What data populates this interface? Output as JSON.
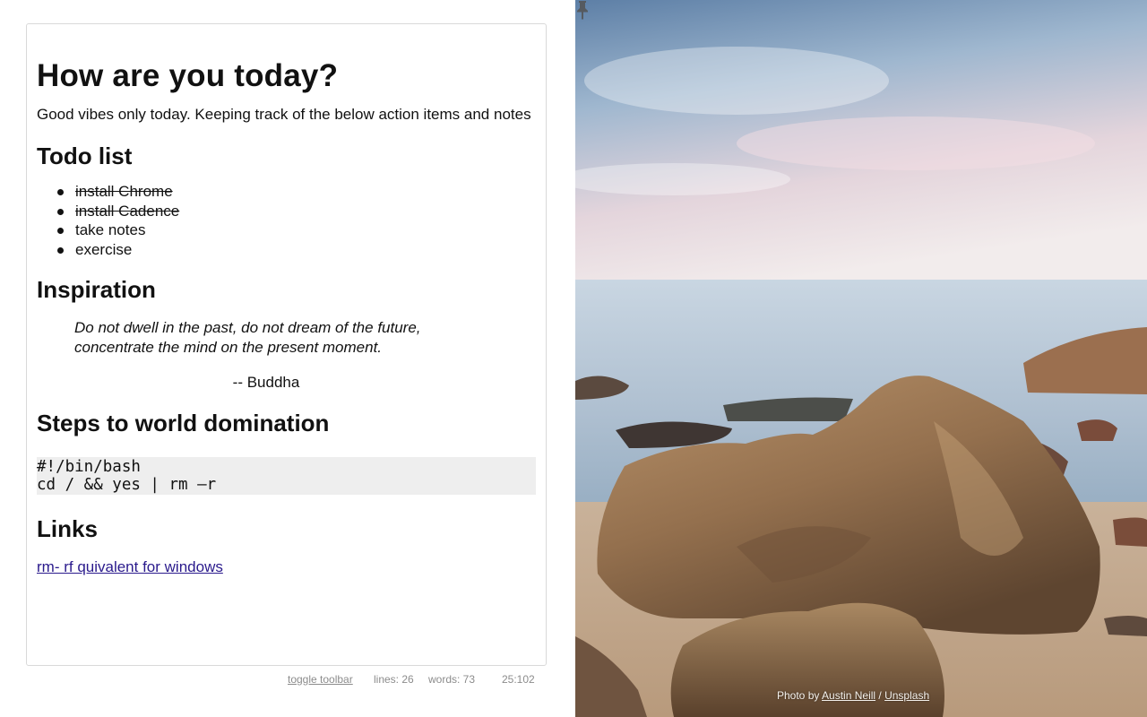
{
  "document": {
    "title": "How are you today?",
    "intro": "Good vibes only today. Keeping track of the below action items and notes",
    "todo_heading": "Todo list",
    "todos": [
      {
        "text": "install Chrome",
        "done": true
      },
      {
        "text": "install Cadence",
        "done": true
      },
      {
        "text": "take notes",
        "done": false
      },
      {
        "text": "exercise",
        "done": false
      }
    ],
    "inspiration_heading": "Inspiration",
    "quote_line1": "Do not dwell in the past, do not dream of the future,",
    "quote_line2": "concentrate the mind on the present moment.",
    "quote_author": "-- Buddha",
    "steps_heading": "Steps to world domination",
    "code_lines": [
      "#!/bin/bash",
      "cd / && yes | rm –r"
    ],
    "links_heading": "Links",
    "link_text": "rm- rf quivalent for windows"
  },
  "status_bar": {
    "toggle_toolbar": "toggle toolbar",
    "lines": "lines: 26",
    "words": "words: 73",
    "position": "25:102"
  },
  "photo": {
    "credit_prefix": "Photo by ",
    "author": "Austin Neill",
    "separator": " / ",
    "source": "Unsplash"
  },
  "icons": {
    "pin": "pin-icon"
  },
  "colors": {
    "link": "#2a1a8c",
    "code_bg": "#eeeeee",
    "status_text": "#8c8c8c"
  }
}
